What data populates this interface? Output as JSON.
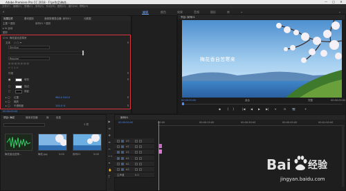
{
  "window": {
    "title": "Adobe Premiere Pro CC 2018 - F:\\pr作品\\梅花...",
    "controls": [
      "—",
      "□",
      "✕"
    ]
  },
  "menu": [
    "文件(F)",
    "编辑(E)",
    "剪辑(C)",
    "序列(S)",
    "标记(M)",
    "图形(G)",
    "窗口(W)",
    "帮助(H)"
  ],
  "workspaces": {
    "items": [
      "编辑",
      "颜色",
      "效果",
      "音频",
      "图形",
      "库"
    ],
    "active_index": 0
  },
  "left_panel": {
    "tabs": [
      "效果控件",
      "基本图形",
      "音频剪辑混合器: 序列01",
      "元数据"
    ],
    "breadcrumb_master": "主要 * 图形",
    "breadcrumb_seq": "序列01 * 图形",
    "section_header": "图形",
    "layer_name": "梅花香自苦寒来",
    "text_heading": "文本",
    "font_name": "SimSun",
    "font_style": "Regular",
    "appearance_heading": "外观",
    "fill_label": "填充",
    "stroke_label": "描边",
    "shadow_label": "阴影",
    "position_label": "位置",
    "position_value": "960.0   540.0",
    "scale_label": "缩放",
    "rotation_label": "旋转",
    "opacity_label": "不透明度",
    "opacity_value": "100.0 %",
    "timecode": "00:00:00:00"
  },
  "program_monitor": {
    "tab": "节目: 序列01",
    "subtitle": "梅花香自苦寒来",
    "timecode_left": "00:00:00:00",
    "fit": "适合",
    "quality": "完整",
    "timecode_right": "00:00:05:00",
    "transport": [
      "◆",
      "{",
      "}",
      "|◀",
      "◀",
      "▶",
      "▶|",
      "⇥",
      "⊡",
      "📷",
      "+"
    ]
  },
  "project_panel": {
    "tabs": [
      "项目: 梅花",
      "媒体浏览器",
      "库",
      "信息"
    ],
    "search_placeholder": "",
    "item_count": "3 项",
    "items": [
      {
        "name": "梅花香自苦寒...",
        "duration": ""
      },
      {
        "name": "梅花.jpg",
        "duration": "5:00"
      },
      {
        "name": "序列01",
        "duration": "5:00"
      }
    ]
  },
  "tools": [
    "▶",
    "⇉",
    "✥",
    "⇹",
    "✂",
    "⟷",
    "✒",
    "✋",
    "T"
  ],
  "timeline": {
    "tab": "序列01",
    "timecode": "00:00:00:00",
    "ruler": [
      "00:00",
      "00:00:15:00",
      "00:00:30:00",
      "00:00:45:00",
      "00:01:00:00"
    ],
    "tracks": [
      "V3",
      "V2",
      "V1",
      "A1",
      "A2",
      "A3",
      "主声道"
    ],
    "master_value": "0.0"
  },
  "watermark": {
    "brand": "Bai",
    "brand_cn": "经验",
    "url": "jingyan.baidu.com"
  },
  "colors": {
    "accent_blue": "#4a8dff",
    "highlight_red": "#d9333f",
    "clip_pink": "#d67ad0",
    "panel_bg": "#232323"
  }
}
